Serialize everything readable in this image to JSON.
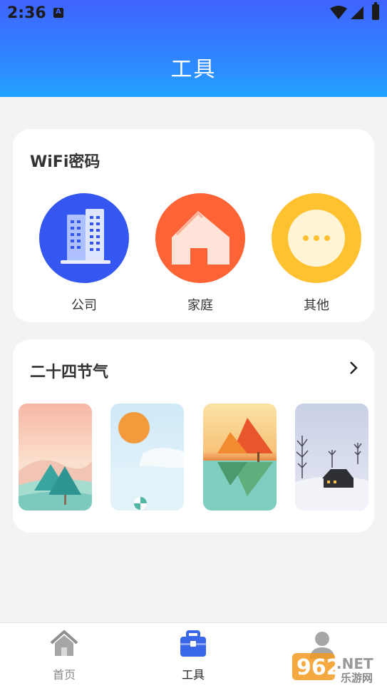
{
  "status": {
    "time": "2:36",
    "notif_letter": "A"
  },
  "header": {
    "title": "工具"
  },
  "wifi": {
    "title": "WiFi密码",
    "items": [
      {
        "label": "公司",
        "icon": "office-building-icon",
        "color": "#3357f0"
      },
      {
        "label": "家庭",
        "icon": "house-icon",
        "color": "#fe6335"
      },
      {
        "label": "其他",
        "icon": "more-dots-icon",
        "color": "#fec130"
      }
    ]
  },
  "solar": {
    "title": "二十四节气",
    "cards": [
      "spring-scene",
      "summer-scene",
      "autumn-scene",
      "winter-scene"
    ]
  },
  "tabbar": {
    "tabs": [
      {
        "label": "首页",
        "icon": "home-icon",
        "active": false
      },
      {
        "label": "工具",
        "icon": "toolbox-icon",
        "active": true
      },
      {
        "label": "",
        "icon": "profile-icon",
        "active": false
      }
    ]
  },
  "watermark": {
    "text1": "962",
    "text2": ".NET",
    "text3": "乐游网"
  }
}
